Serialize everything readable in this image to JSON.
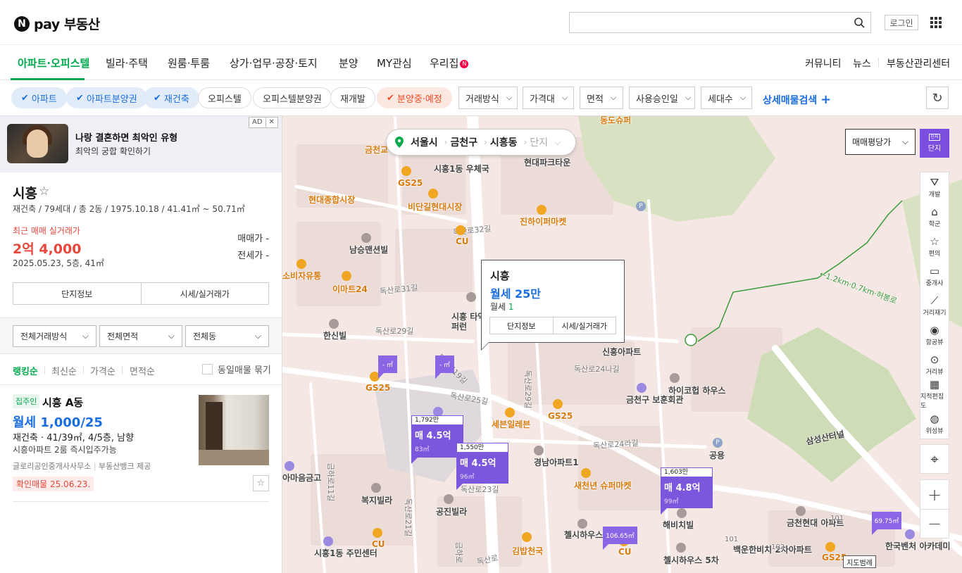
{
  "header": {
    "logo_n": "N",
    "logo_text": "pay 부동산",
    "login": "로그인",
    "search_placeholder": ""
  },
  "nav": {
    "items": [
      "아파트·오피스텔",
      "빌라·주택",
      "원룸·투룸",
      "상가·업무·공장·토지",
      "분양",
      "MY관심",
      "우리집"
    ],
    "new_badge": "N",
    "right": [
      "커뮤니티",
      "뉴스",
      "부동산관리센터"
    ]
  },
  "filters": {
    "chips": [
      {
        "label": "아파트",
        "checked": true,
        "style": "blue"
      },
      {
        "label": "아파트분양권",
        "checked": true,
        "style": "blue"
      },
      {
        "label": "재건축",
        "checked": true,
        "style": "blue"
      },
      {
        "label": "오피스텔",
        "checked": false,
        "style": "plain"
      },
      {
        "label": "오피스텔분양권",
        "checked": false,
        "style": "plain"
      },
      {
        "label": "재개발",
        "checked": false,
        "style": "plain"
      },
      {
        "label": "분양중·예정",
        "checked": true,
        "style": "red"
      }
    ],
    "dropdowns": [
      "거래방식",
      "가격대",
      "면적",
      "사용승인일",
      "세대수"
    ],
    "detail_search": "상세매물검색",
    "colors": {
      "blue": "#1a6ee0",
      "green": "#03a94d",
      "red": "#f04a26",
      "purple": "#7b57dd"
    }
  },
  "ad": {
    "title": "나랑 결혼하면 최악인 유형",
    "subtitle": "최악의 궁합 확인하기",
    "badge": "AD",
    "close": "✕"
  },
  "complex": {
    "name": "시흥",
    "meta": "재건축 / 79세대 / 총 2동 / 1975.10.18 / 41.41㎡ ~ 50.71㎡",
    "recent_label": "최근 매매 실거래가",
    "recent_price": "2억 4,000",
    "recent_date": "2025.05.23, 5층, 41㎡",
    "sale_price": "매매가 -",
    "jeonse_price": "전세가 -",
    "btn_info": "단지정보",
    "btn_price": "시세/실거래가"
  },
  "selects": [
    "전체거래방식",
    "전체면적",
    "전체동"
  ],
  "sort": {
    "items": [
      "랭킹순",
      "최신순",
      "가격순",
      "면적순"
    ],
    "dup": "동일매물 묶기"
  },
  "listing": {
    "tag": "집주인",
    "name": "시흥 A동",
    "price": "월세 1,000/25",
    "spec": "재건축 · 41/39㎡, 4/5층, 남향",
    "desc": "시흥아파트 2룸 즉시입주가능",
    "agent": "글로리공인중개사사무소",
    "provider": "부동산뱅크 제공",
    "confirm": "확인매물 25.06.23."
  },
  "map": {
    "location": [
      "서울시",
      "금천구",
      "시흥동",
      "단지"
    ],
    "price_type": "매매평당가",
    "danji_label": "단지",
    "danji_icon": "단지",
    "tools": [
      "개발",
      "학군",
      "편의",
      "중개사",
      "거리재기",
      "항공뷰",
      "거리뷰",
      "지적편집도",
      "위성뷰"
    ],
    "scale": "지도범례",
    "popup": {
      "title": "시흥",
      "price": "월세 25만",
      "line_label": "월세",
      "line_count": "1",
      "btn_info": "단지정보",
      "btn_price": "시세/실거래가"
    },
    "markers": [
      {
        "hdr": "1,792만",
        "main": "매 4.5억",
        "area": "83㎡"
      },
      {
        "hdr": "1,550만",
        "main": "매 4.5억",
        "area": "96㎡"
      },
      {
        "hdr": "1,603만",
        "main": "매 4.8억",
        "area": "99㎡"
      }
    ],
    "minis": [
      "- ㎡",
      "- ㎡",
      "106.65㎡",
      "69.75㎡"
    ],
    "labels": {
      "poi": [
        "현대종합시장",
        "비단길현대시장",
        "진하이퍼마켓",
        "남승맨션빌",
        "소비자유통",
        "이마트24",
        "한신빌",
        "시흥1동 우체국",
        "현대파크타운",
        "신흥아파트",
        "하이코헙 하우스",
        "금천구 보훈회관",
        "세븐일레븐",
        "경남아파트1",
        "새천년 슈퍼마켓",
        "복지빌라",
        "공진빌라",
        "김밥천국",
        "첼시하우스 2차",
        "첼시하우스 5차",
        "해비치빌",
        "백운한비치 2차아파트",
        "금천현대 아파트",
        "한국벤처 아카데미",
        "시흥1동 주민센터",
        "동도슈퍼",
        "금천교",
        "삼성산터널",
        "공용"
      ],
      "cvs": [
        "GS25",
        "CU",
        "GS25",
        "GS25",
        "CU",
        "CU",
        "GS25"
      ],
      "roads": [
        "독산로32길",
        "독산로31길",
        "독산로29길",
        "독산로25길",
        "독산로24나길",
        "독산로24라길",
        "독산로23길",
        "독산로29길",
        "독산로",
        "금하로11길",
        "독산로21길",
        "독산로19길",
        "금하로"
      ],
      "trail": "←1.2km·0.7km·허봉로",
      "num101a": "101",
      "num101b": "101",
      "num102": "102",
      "danji_tags": [
        "아마음금고",
        "시흥 타악컴퍼런"
      ]
    }
  }
}
